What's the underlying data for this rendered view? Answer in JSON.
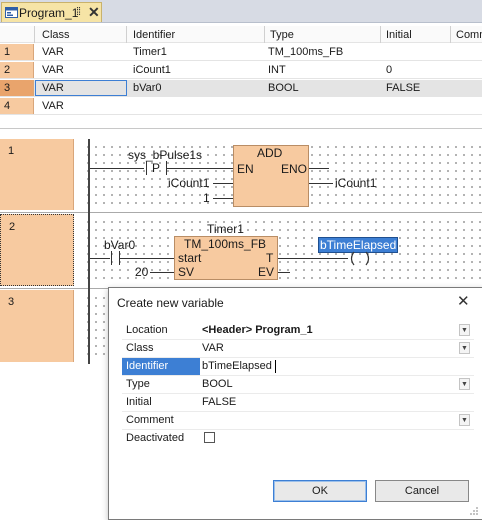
{
  "tab": {
    "label": "Program_1",
    "pin_glyph": "⁞⁞",
    "close_glyph": "✕"
  },
  "grid": {
    "headers": [
      "Class",
      "Identifier",
      "Type",
      "Initial",
      "Comm"
    ],
    "rows": [
      {
        "num": "1",
        "class": "VAR",
        "identifier": "Timer1",
        "type": "TM_100ms_FB",
        "initial": ""
      },
      {
        "num": "2",
        "class": "VAR",
        "identifier": "iCount1",
        "type": "INT",
        "initial": "0"
      },
      {
        "num": "3",
        "class": "VAR",
        "identifier": "bVar0",
        "type": "BOOL",
        "initial": "FALSE"
      },
      {
        "num": "4",
        "class": "VAR",
        "identifier": "",
        "type": "",
        "initial": ""
      }
    ]
  },
  "ladder": {
    "networks": [
      "1",
      "2",
      "3"
    ],
    "net1": {
      "input_var": "sys_bPulse1s",
      "edge": "P",
      "block": "ADD",
      "en": "EN",
      "eno": "ENO",
      "in_var": "iCount1",
      "in_const": "1",
      "out_var": "iCount1"
    },
    "net2": {
      "instance": "Timer1",
      "block": "TM_100ms_FB",
      "contact_var": "bVar0",
      "start": "start",
      "sv": "SV",
      "preset": "20",
      "t": "T",
      "ev": "EV",
      "coil_var": "bTimeElapsed"
    }
  },
  "dialog": {
    "title": "Create new variable",
    "close_glyph": "✕",
    "fields": [
      {
        "key": "Location",
        "value": "<Header> Program_1",
        "dropdown": true
      },
      {
        "key": "Class",
        "value": "VAR",
        "dropdown": true
      },
      {
        "key": "Identifier",
        "value": "bTimeElapsed",
        "dropdown": false
      },
      {
        "key": "Type",
        "value": "BOOL",
        "dropdown": true
      },
      {
        "key": "Initial",
        "value": "FALSE",
        "dropdown": false
      },
      {
        "key": "Comment",
        "value": "",
        "dropdown": true
      },
      {
        "key": "Deactivated",
        "value": "",
        "dropdown": false
      }
    ],
    "ok_label": "OK",
    "cancel_label": "Cancel"
  },
  "colors": {
    "accent": "#3d7fd4",
    "network_bg": "#f7caa0",
    "tab_bg": "#f6e4a6",
    "selected_row": "#e4e4e4"
  }
}
